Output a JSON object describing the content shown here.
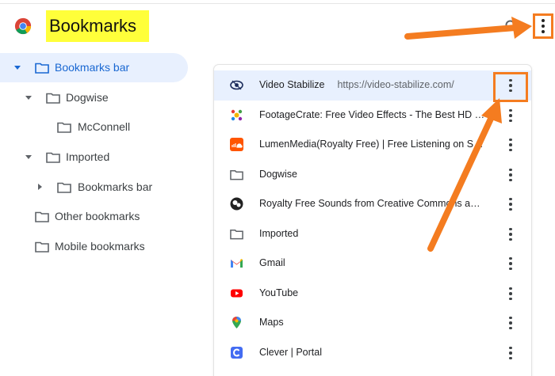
{
  "header": {
    "title": "Bookmarks"
  },
  "sidebar": {
    "items": [
      {
        "label": "Bookmarks bar",
        "caret": "down",
        "selected": true
      },
      {
        "label": "Dogwise",
        "caret": "down",
        "selected": false
      },
      {
        "label": "McConnell",
        "caret": "none",
        "selected": false
      },
      {
        "label": "Imported",
        "caret": "down",
        "selected": false
      },
      {
        "label": "Bookmarks bar",
        "caret": "right",
        "selected": false
      },
      {
        "label": "Other bookmarks",
        "caret": "none",
        "selected": false
      },
      {
        "label": "Mobile bookmarks",
        "caret": "none",
        "selected": false
      }
    ]
  },
  "list": {
    "items": [
      {
        "title": "Video Stabilize",
        "url": "https://video-stabilize.com/",
        "icon": "video-stabilize-icon"
      },
      {
        "title": "FootageCrate: Free Video Effects - The Best HD & …",
        "url": "",
        "icon": "footagecrate-icon"
      },
      {
        "title": "LumenMedia(Royalty Free) | Free Listening on Sou…",
        "url": "",
        "icon": "soundcloud-icon"
      },
      {
        "title": "Dogwise",
        "url": "",
        "icon": "folder-icon"
      },
      {
        "title": "Royalty Free Sounds from Creative Commons and …",
        "url": "",
        "icon": "ccmixter-icon"
      },
      {
        "title": "Imported",
        "url": "",
        "icon": "folder-icon"
      },
      {
        "title": "Gmail",
        "url": "",
        "icon": "gmail-icon"
      },
      {
        "title": "YouTube",
        "url": "",
        "icon": "youtube-icon"
      },
      {
        "title": "Maps",
        "url": "",
        "icon": "maps-icon"
      },
      {
        "title": "Clever | Portal",
        "url": "",
        "icon": "clever-icon"
      }
    ]
  },
  "colors": {
    "accent": "#1967d2",
    "selected_bg": "#e8f0fe",
    "annotation": "#f47c20",
    "highlight": "#ffff3a"
  }
}
